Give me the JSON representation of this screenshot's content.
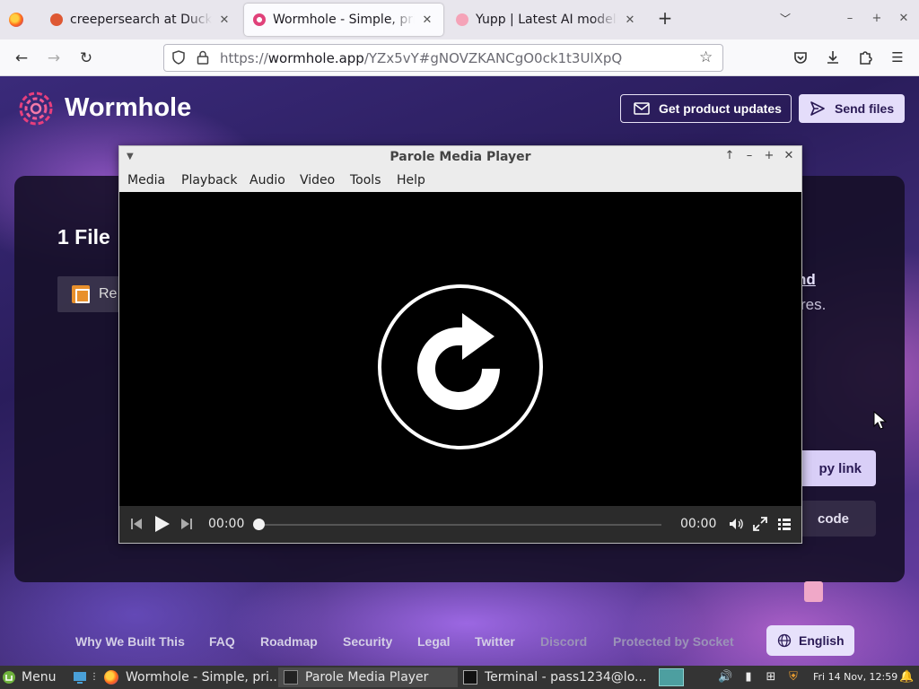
{
  "browser": {
    "tabs": [
      {
        "title": "creepersearch at DuckD",
        "favicon_color": "#de5833",
        "active": false
      },
      {
        "title": "Wormhole - Simple, priv",
        "favicon_color": "#e0417a",
        "active": true
      },
      {
        "title": "Yupp | Latest AI models",
        "favicon_color": "#f06292",
        "active": false
      }
    ],
    "url_prefix": "https://",
    "url_host": "wormhole.app",
    "url_rest": "/YZx5vY#gNOVZKANCgO0ck1t3UlXpQ"
  },
  "page": {
    "brand": "Wormhole",
    "updates_button": "Get product updates",
    "send_button": "Send files",
    "card_title": "1 File",
    "file_name_partial": "Re",
    "side_text_link_partial": "nd",
    "side_text_line_partial": "res.",
    "copy_link_partial": "py link",
    "code_partial": "code",
    "footer_links": [
      "Why We Built This",
      "FAQ",
      "Roadmap",
      "Security",
      "Legal",
      "Twitter",
      "Discord",
      "Protected by Socket"
    ],
    "language_button": "English",
    "accent_color": "#e4ddfa"
  },
  "player": {
    "title": "Parole Media Player",
    "menu": [
      "Media",
      "Playback",
      "Audio",
      "Video",
      "Tools",
      "Help"
    ],
    "time_current": "00:00",
    "time_total": "00:00",
    "progress": 0
  },
  "taskbar": {
    "menu_label": "Menu",
    "tasks": [
      {
        "label": "Wormhole - Simple, pri...",
        "active": false
      },
      {
        "label": "Parole Media Player",
        "active": true
      },
      {
        "label": "Terminal - pass1234@lo...",
        "active": false
      }
    ],
    "clock": "Fri 14 Nov, 12:59"
  }
}
